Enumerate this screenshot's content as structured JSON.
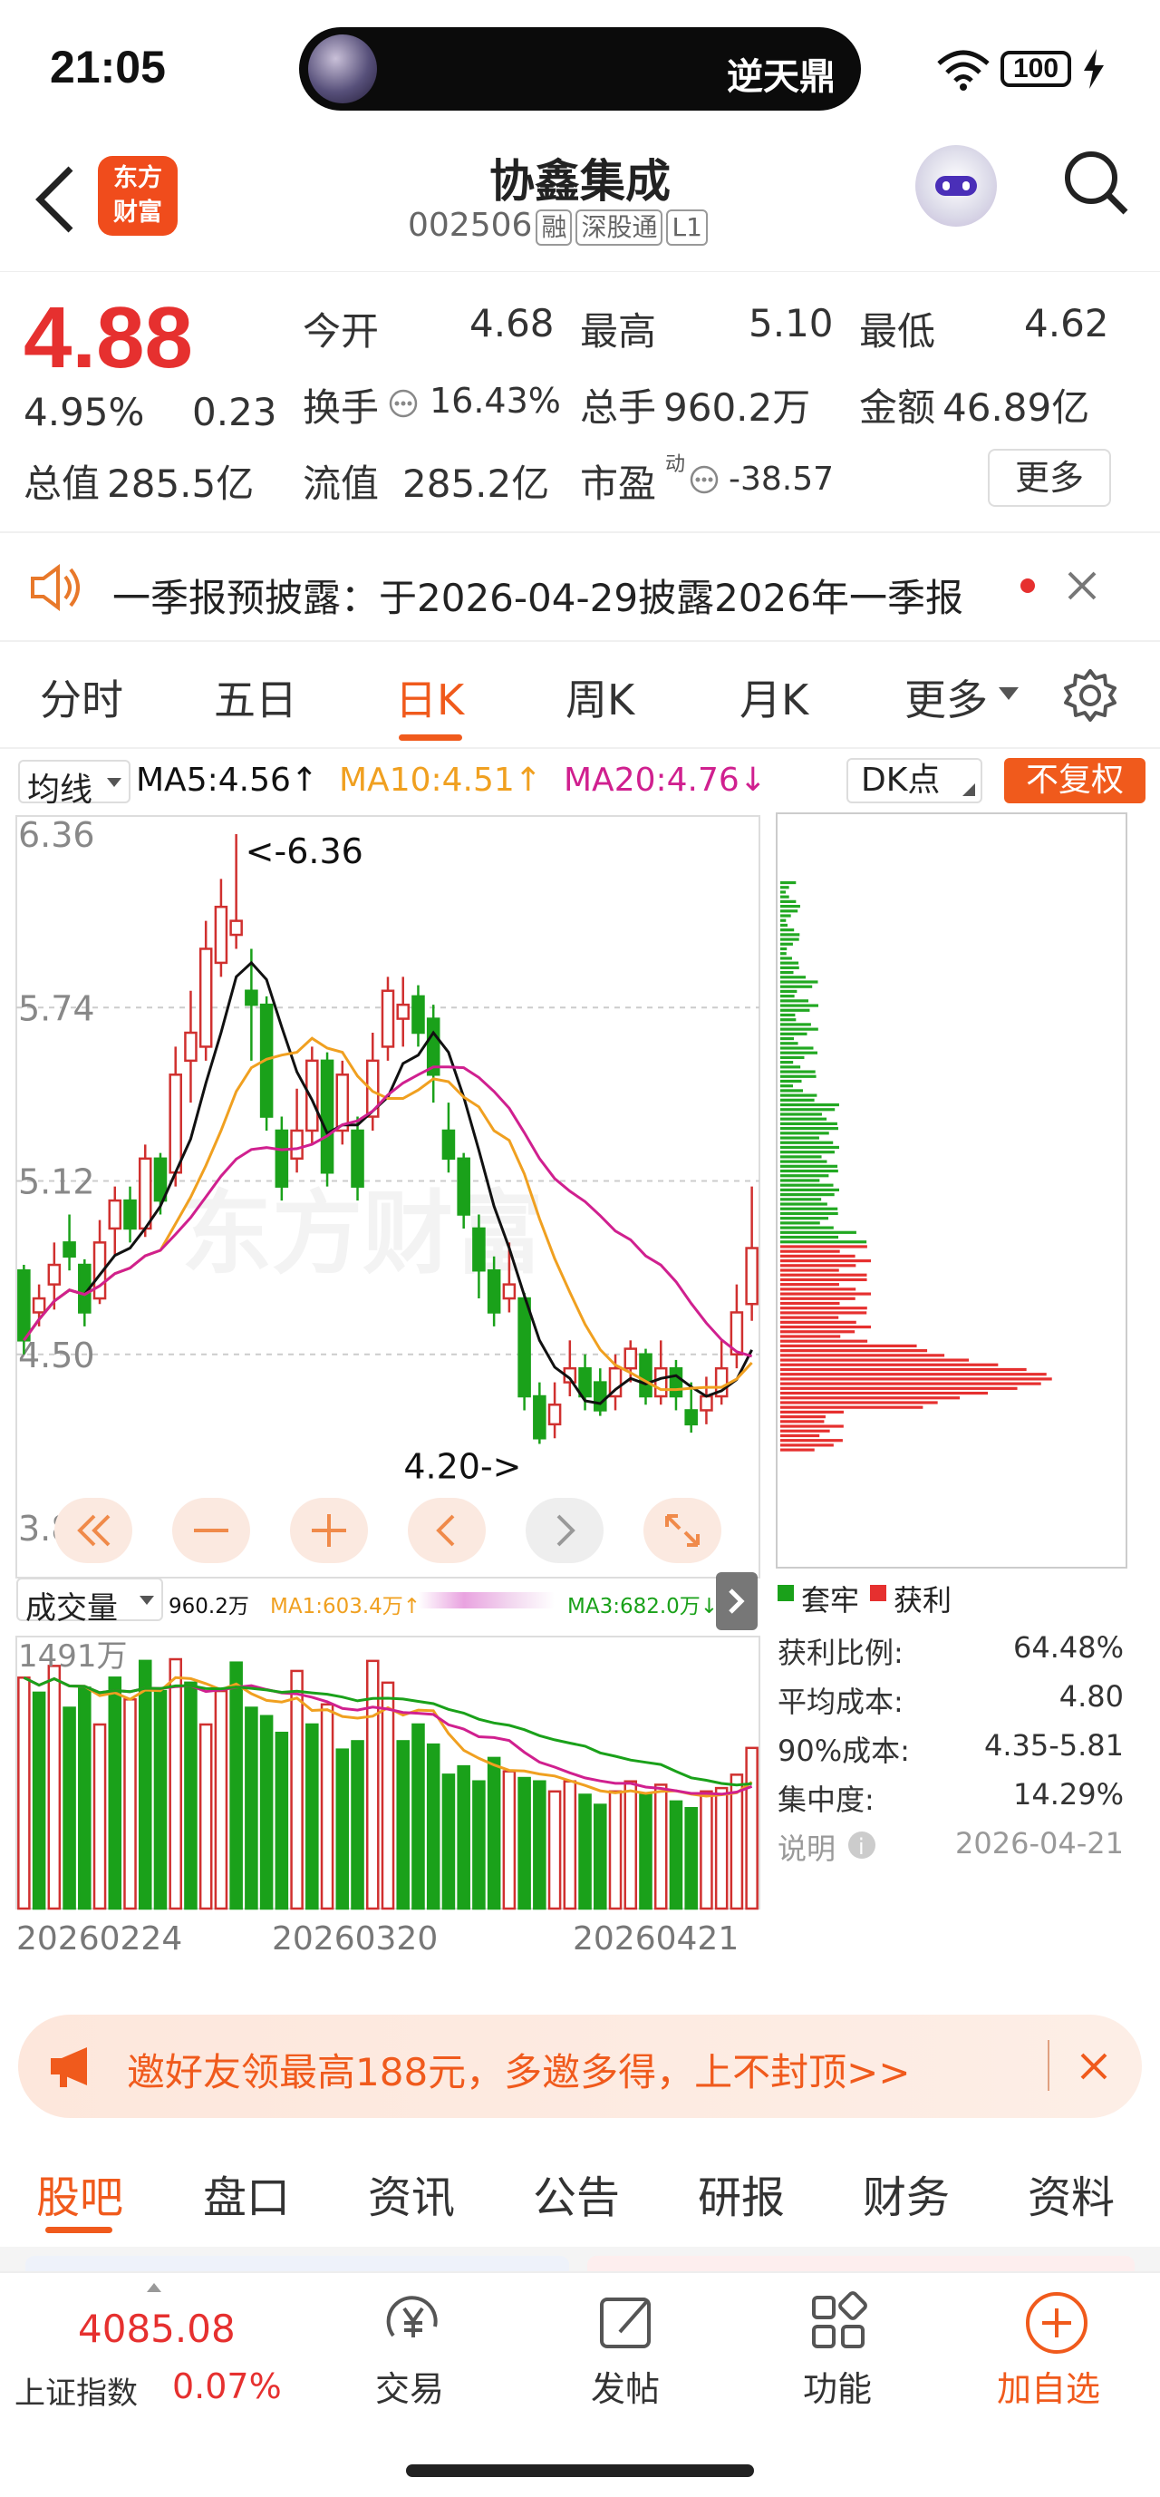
{
  "status_bar": {
    "time": "21:05",
    "island_title": "逆天鼎",
    "battery": "100"
  },
  "header": {
    "logo_line1": "东方",
    "logo_line2": "财富",
    "stock_name": "协鑫集成",
    "stock_code": "002506",
    "tags": [
      "融",
      "深股通",
      "L1"
    ]
  },
  "quote": {
    "price": "4.88",
    "change_pct": "4.95%",
    "change": "0.23",
    "open_label": "今开",
    "open": "4.68",
    "high_label": "最高",
    "high": "5.10",
    "low_label": "最低",
    "low": "4.62",
    "turnover_label": "换手",
    "turnover": "16.43%",
    "volume_label": "总手",
    "volume": "960.2万",
    "amount_label": "金额",
    "amount": "46.89亿",
    "mcap_label": "总值",
    "mcap": "285.5亿",
    "float_label": "流值",
    "float_mcap": "285.2亿",
    "pe_label": "市盈",
    "pe_sup": "动",
    "pe": "-38.57",
    "more": "更多"
  },
  "notice": {
    "text": "一季报预披露：于2026-04-29披露2026年一季报"
  },
  "chart_tabs": [
    "分时",
    "五日",
    "日K",
    "周K",
    "月K",
    "更多"
  ],
  "active_tab": "日K",
  "ma": {
    "label": "均线",
    "ma5": "MA5:4.56",
    "ma10": "MA10:4.51",
    "ma20": "MA20:4.76",
    "dk": "DK点",
    "fuquan": "不复权"
  },
  "chart_data": {
    "type": "candlestick",
    "y_ticks": [
      "6.36",
      "5.74",
      "5.12",
      "4.50",
      "3.88"
    ],
    "ylim": [
      3.88,
      6.36
    ],
    "annotations": [
      "<-6.36",
      "4.20->"
    ],
    "candles": [
      [
        4.8,
        4.55,
        4.82,
        4.5
      ],
      [
        4.65,
        4.7,
        4.75,
        4.6
      ],
      [
        4.75,
        4.82,
        4.9,
        4.66
      ],
      [
        4.9,
        4.85,
        5.0,
        4.8
      ],
      [
        4.82,
        4.65,
        4.84,
        4.6
      ],
      [
        4.7,
        4.9,
        4.98,
        4.68
      ],
      [
        4.95,
        5.05,
        5.1,
        4.85
      ],
      [
        5.05,
        4.95,
        5.1,
        4.9
      ],
      [
        4.95,
        5.2,
        5.25,
        4.92
      ],
      [
        5.2,
        5.05,
        5.22,
        5.0
      ],
      [
        5.15,
        5.5,
        5.6,
        5.1
      ],
      [
        5.55,
        5.65,
        5.8,
        5.4
      ],
      [
        5.6,
        5.95,
        6.05,
        5.55
      ],
      [
        5.9,
        6.1,
        6.2,
        5.85
      ],
      [
        6.0,
        6.05,
        6.36,
        5.95
      ],
      [
        5.8,
        5.75,
        5.95,
        5.55
      ],
      [
        5.75,
        5.35,
        5.78,
        5.3
      ],
      [
        5.3,
        5.1,
        5.35,
        5.05
      ],
      [
        5.2,
        5.3,
        5.45,
        5.15
      ],
      [
        5.3,
        5.55,
        5.6,
        5.25
      ],
      [
        5.55,
        5.15,
        5.58,
        5.1
      ],
      [
        5.3,
        5.5,
        5.55,
        5.25
      ],
      [
        5.3,
        5.1,
        5.35,
        5.05
      ],
      [
        5.35,
        5.55,
        5.65,
        5.3
      ],
      [
        5.6,
        5.8,
        5.85,
        5.55
      ],
      [
        5.7,
        5.75,
        5.85,
        5.6
      ],
      [
        5.78,
        5.65,
        5.82,
        5.6
      ],
      [
        5.7,
        5.5,
        5.75,
        5.4
      ],
      [
        5.3,
        5.2,
        5.4,
        5.15
      ],
      [
        5.2,
        5.0,
        5.22,
        4.95
      ],
      [
        4.95,
        4.8,
        5.0,
        4.7
      ],
      [
        4.8,
        4.65,
        4.85,
        4.6
      ],
      [
        4.7,
        4.75,
        4.9,
        4.65
      ],
      [
        4.7,
        4.35,
        4.72,
        4.3
      ],
      [
        4.35,
        4.2,
        4.4,
        4.18
      ],
      [
        4.25,
        4.32,
        4.4,
        4.2
      ],
      [
        4.4,
        4.45,
        4.55,
        4.35
      ],
      [
        4.45,
        4.35,
        4.5,
        4.3
      ],
      [
        4.4,
        4.3,
        4.45,
        4.28
      ],
      [
        4.35,
        4.45,
        4.5,
        4.3
      ],
      [
        4.45,
        4.52,
        4.55,
        4.4
      ],
      [
        4.5,
        4.35,
        4.52,
        4.32
      ],
      [
        4.35,
        4.45,
        4.55,
        4.32
      ],
      [
        4.45,
        4.35,
        4.48,
        4.3
      ],
      [
        4.3,
        4.25,
        4.4,
        4.22
      ],
      [
        4.3,
        4.35,
        4.42,
        4.25
      ],
      [
        4.35,
        4.45,
        4.55,
        4.32
      ],
      [
        4.5,
        4.65,
        4.75,
        4.45
      ],
      [
        4.68,
        4.88,
        5.1,
        4.62
      ]
    ],
    "volume_label": "成交量",
    "volume_value": "960.2万",
    "vol_ma1": "MA1:603.4万",
    "vol_ma3": "MA3:682.0万",
    "volume_max": "1491万",
    "volumes": [
      1380,
      1290,
      1450,
      1200,
      1320,
      1100,
      1380,
      1250,
      1480,
      1300,
      1490,
      1350,
      1100,
      1300,
      1470,
      1200,
      1150,
      1050,
      1420,
      1100,
      1220,
      950,
      1000,
      1480,
      1350,
      1000,
      1100,
      980,
      800,
      850,
      760,
      900,
      820,
      780,
      760,
      700,
      760,
      680,
      620,
      700,
      760,
      680,
      740,
      640,
      600,
      700,
      720,
      800,
      960
    ],
    "volume_up": [
      true,
      false,
      true,
      false,
      false,
      true,
      false,
      true,
      false,
      false,
      true,
      false,
      true,
      true,
      false,
      false,
      false,
      false,
      true,
      false,
      true,
      false,
      false,
      true,
      true,
      false,
      false,
      false,
      false,
      false,
      false,
      false,
      true,
      false,
      false,
      true,
      true,
      false,
      false,
      true,
      true,
      false,
      true,
      false,
      false,
      true,
      true,
      true,
      true
    ],
    "x_labels": [
      "20260224",
      "20260320",
      "20260421"
    ]
  },
  "chip": {
    "legend_trap": "套牢",
    "legend_profit": "获利",
    "rows": [
      {
        "k": "获利比例:",
        "v": "64.48%"
      },
      {
        "k": "平均成本:",
        "v": "4.80"
      },
      {
        "k": "90%成本:",
        "v": "4.35-5.81"
      },
      {
        "k": "集中度:",
        "v": "14.29%"
      },
      {
        "k": "说明",
        "v": "2026-04-21"
      }
    ]
  },
  "promo": {
    "text": "邀好友领最高188元，多邀多得，上不封顶>>"
  },
  "bottom_tabs": [
    "股吧",
    "盘口",
    "资讯",
    "公告",
    "研报",
    "财务",
    "资料"
  ],
  "index": {
    "value": "4085.08",
    "name": "上证指数",
    "pct": "0.07%"
  },
  "bottom_nav": [
    "交易",
    "发帖",
    "功能",
    "加自选"
  ]
}
